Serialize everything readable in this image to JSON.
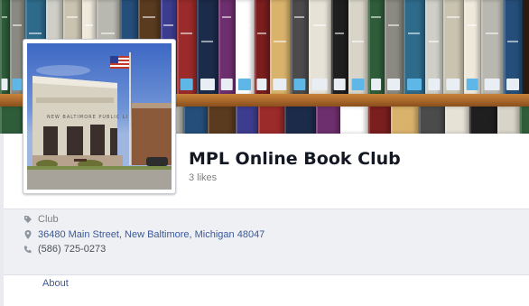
{
  "page": {
    "name": "MPL Online Book Club",
    "likes": "3 likes"
  },
  "profile_photo": {
    "building_sign": "NEW BALTIMORE PUBLIC LIBRARY",
    "colors": {
      "sky": "#3d68c4",
      "building": "#d8d2c2",
      "grass": "#7c8c4a"
    }
  },
  "info": {
    "category": "Club",
    "address": "36480 Main Street, New Baltimore, Michigan 48047",
    "phone": "(586) 725-0273"
  },
  "nav": {
    "about": "About"
  },
  "icons": {
    "category": "tag-icon",
    "address": "map-pin-icon",
    "phone": "phone-icon"
  },
  "colors": {
    "link": "#3b5998",
    "name": "#141823",
    "muted": "#7f7f7f",
    "panel_bg": "#eef0f4"
  }
}
